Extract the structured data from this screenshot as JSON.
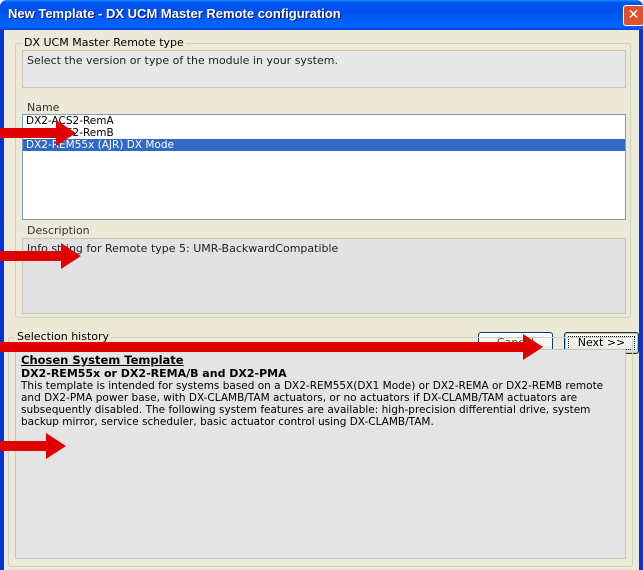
{
  "window": {
    "title": "New Template - DX UCM Master Remote configuration",
    "close_glyph": "✕"
  },
  "type_group": {
    "legend": "DX UCM Master Remote type",
    "instruction": "Select the version or type of the module in your system.",
    "name_label": "Name",
    "items": [
      {
        "label": "DX2-ACS2-RemA",
        "selected": false
      },
      {
        "label": "DX2-ACS2-RemB",
        "selected": false
      },
      {
        "label": "DX2-REM55x (AJR) DX Mode",
        "selected": true
      }
    ],
    "description_label": "Description",
    "description": "Info string for Remote type 5: UMR-BackwardCompatible"
  },
  "buttons": {
    "cancel_label": "Cancel",
    "next_label": "Next >>"
  },
  "history_group": {
    "legend": "Selection history",
    "title": "Chosen System Template",
    "subtitle": "DX2-REM55x or DX2-REMA/B and DX2-PMA",
    "body": "This template is intended for systems based on a DX2-REM55X(DX1 Mode) or DX2-REMA or DX2-REMB remote and DX2-PMA power base, with DX-CLAMB/TAM actuators, or no actuators if DX-CLAMB/TAM actuators are subsequently disabled. The following system features are available: high-precision differential drive, system backup mirror, service scheduler, basic actuator control using DX-CLAMB/TAM."
  },
  "annotations": {
    "arrow_color": "#e00000"
  },
  "colors": {
    "title_bar": "#0053ee",
    "selection": "#316ac5",
    "dialog_bg": "#ece9d8"
  }
}
